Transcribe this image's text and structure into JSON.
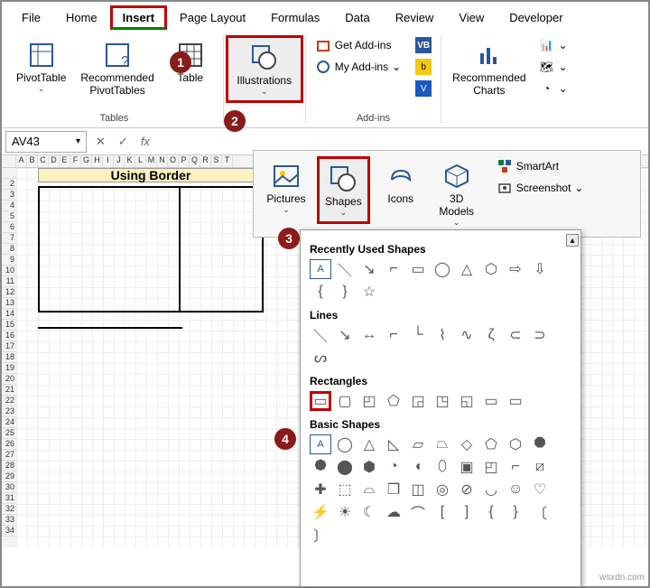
{
  "menu": {
    "file": "File",
    "home": "Home",
    "insert": "Insert",
    "page_layout": "Page Layout",
    "formulas": "Formulas",
    "data": "Data",
    "review": "Review",
    "view": "View",
    "developer": "Developer"
  },
  "ribbon": {
    "tables": {
      "label": "Tables",
      "pivottable": "PivotTable",
      "recommended_pivot": "Recommended\nPivotTables",
      "table": "Table"
    },
    "illustrations": {
      "label": "Illustrations",
      "btn": "Illustrations"
    },
    "addins": {
      "label": "Add-ins",
      "get": "Get Add-ins",
      "my": "My Add-ins"
    },
    "charts": {
      "label": "Recommended\nCharts"
    }
  },
  "subribbon": {
    "pictures": "Pictures",
    "shapes": "Shapes",
    "icons": "Icons",
    "models": "3D\nModels",
    "smartart": "SmartArt",
    "screenshot": "Screenshot"
  },
  "fbar": {
    "name": "AV43",
    "fx": "fx"
  },
  "sheet": {
    "title": "Using Border"
  },
  "shapes_dd": {
    "recent": "Recently Used Shapes",
    "lines": "Lines",
    "rect": "Rectangles",
    "basic": "Basic Shapes"
  },
  "steps": {
    "s1": "1",
    "s2": "2",
    "s3": "3",
    "s4": "4"
  },
  "watermark": "wsxdn.com"
}
